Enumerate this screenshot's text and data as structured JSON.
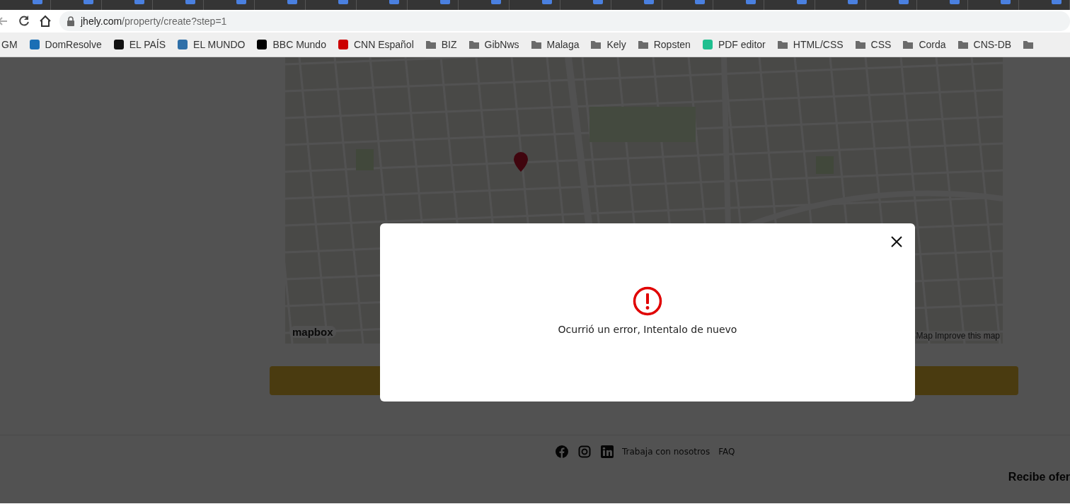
{
  "address_bar": {
    "host": "jhely.com",
    "path": "/property/create?step=1"
  },
  "bookmarks": [
    {
      "label": "GM",
      "kind": "plain"
    },
    {
      "label": "DomResolve",
      "kind": "site",
      "color": "#1a6fb5"
    },
    {
      "label": "EL PAÍS",
      "kind": "site",
      "color": "#111111"
    },
    {
      "label": "EL MUNDO",
      "kind": "site",
      "color": "#2f6fa8"
    },
    {
      "label": "BBC Mundo",
      "kind": "site",
      "color": "#000000"
    },
    {
      "label": "CNN Español",
      "kind": "site",
      "color": "#cc0000"
    },
    {
      "label": "BIZ",
      "kind": "folder"
    },
    {
      "label": "GibNws",
      "kind": "folder"
    },
    {
      "label": "Malaga",
      "kind": "folder"
    },
    {
      "label": "Kely",
      "kind": "folder"
    },
    {
      "label": "Ropsten",
      "kind": "folder"
    },
    {
      "label": "PDF editor",
      "kind": "site",
      "color": "#1fbf8f"
    },
    {
      "label": "HTML/CSS",
      "kind": "folder"
    },
    {
      "label": "CSS",
      "kind": "folder"
    },
    {
      "label": "Corda",
      "kind": "folder"
    },
    {
      "label": "CNS-DB",
      "kind": "folder"
    },
    {
      "kind": "folder"
    }
  ],
  "map": {
    "logo": "mapbox",
    "attribution": "Map",
    "improve_link": "Improve this map"
  },
  "dialog": {
    "message": "Ocurrió un error, Intentalo de nuevo"
  },
  "footer": {
    "links": [
      "Trabaja con nosotros",
      "FAQ"
    ],
    "newsletter_heading": "Recibe ofer"
  }
}
